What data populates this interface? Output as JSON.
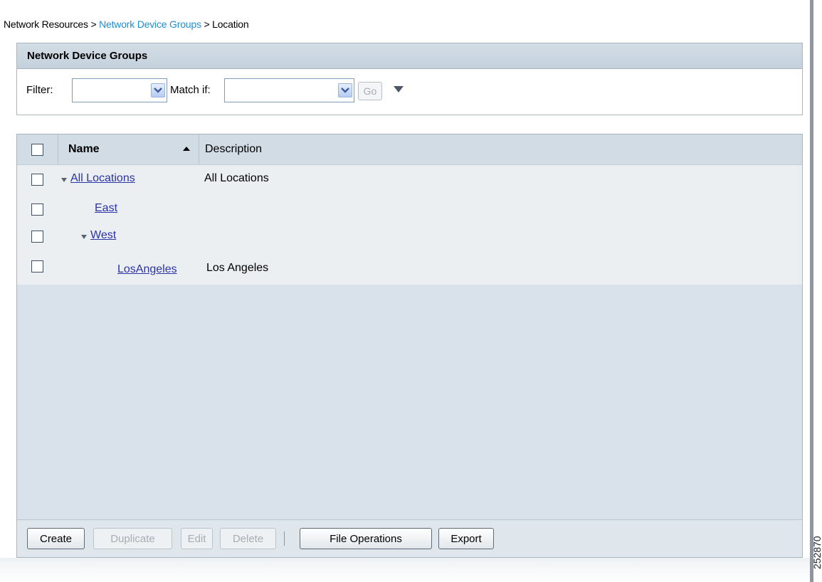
{
  "breadcrumb": {
    "part1": "Network Resources >",
    "part2": "Network Device Groups",
    "part3": "> Location"
  },
  "filter_panel": {
    "title": "Network Device Groups",
    "filter_label": "Filter:",
    "match_label": "Match if:",
    "go_label": "Go"
  },
  "table": {
    "headers": {
      "name": "Name",
      "description": "Description"
    },
    "rows": [
      {
        "name": "All Locations",
        "description": "All Locations"
      },
      {
        "name": "East",
        "description": ""
      },
      {
        "name": "West",
        "description": ""
      },
      {
        "name": "LosAngeles",
        "description": "Los Angeles"
      }
    ]
  },
  "footer": {
    "create": "Create",
    "duplicate": "Duplicate",
    "edit": "Edit",
    "delete": "Delete",
    "file_operations": "File Operations",
    "export": "Export"
  },
  "image_id": "252870",
  "colors": {
    "link": "#2a33a8",
    "breadcrumb_link": "#1f8fd0",
    "header_bg": "#d2dce5",
    "panel_bg": "#d9e2ea"
  }
}
